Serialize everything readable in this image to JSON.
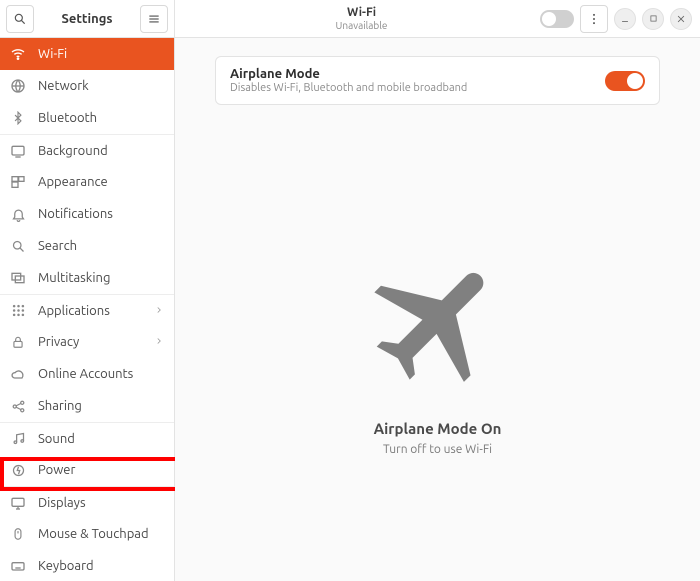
{
  "sidebar": {
    "title": "Settings",
    "items": [
      {
        "label": "Wi-Fi"
      },
      {
        "label": "Network"
      },
      {
        "label": "Bluetooth"
      },
      {
        "label": "Background"
      },
      {
        "label": "Appearance"
      },
      {
        "label": "Notifications"
      },
      {
        "label": "Search"
      },
      {
        "label": "Multitasking"
      },
      {
        "label": "Applications"
      },
      {
        "label": "Privacy"
      },
      {
        "label": "Online Accounts"
      },
      {
        "label": "Sharing"
      },
      {
        "label": "Sound"
      },
      {
        "label": "Power"
      },
      {
        "label": "Displays"
      },
      {
        "label": "Mouse & Touchpad"
      },
      {
        "label": "Keyboard"
      }
    ]
  },
  "header": {
    "title": "Wi-Fi",
    "subtitle": "Unavailable"
  },
  "card": {
    "title": "Airplane Mode",
    "subtitle": "Disables Wi-Fi, Bluetooth and mobile broadband"
  },
  "empty": {
    "title": "Airplane Mode On",
    "subtitle": "Turn off to use Wi-Fi"
  },
  "colors": {
    "accent": "#e95420"
  }
}
